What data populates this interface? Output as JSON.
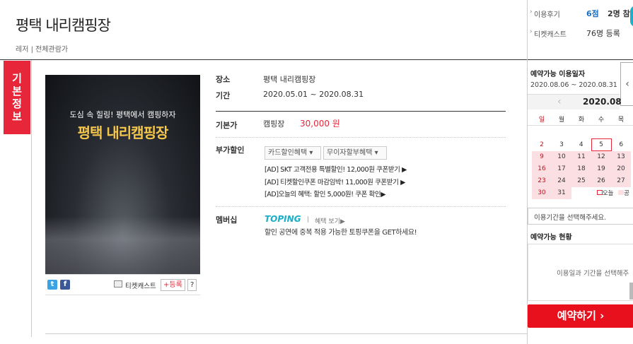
{
  "header": {
    "title": "평택 내리캠핑장",
    "breadcrumb": "레저 | 전체관람가"
  },
  "side_tab": {
    "chars": [
      "기",
      "본",
      "정",
      "보"
    ]
  },
  "poster": {
    "subtitle": "도심 속 힐링! 평택에서 캠핑하자",
    "main": "평택 내리캠핑장"
  },
  "poster_bar": {
    "ticketcast": "티켓캐스트",
    "register": "+등록",
    "help": "?"
  },
  "info": {
    "place_label": "장소",
    "place_value": "평택 내리캠핑장",
    "period_label": "기간",
    "period_value": "2020.05.01 ~ 2020.08.31",
    "price_label": "기본가",
    "price_item": "캠핑장",
    "price_value": "30,000 원",
    "discount_label": "부가할인",
    "card_btn": "카드할인혜택",
    "install_btn": "무이자할부혜택",
    "ads": [
      "[AD] SKT 고객전용 특별할인! 12,000원 쿠폰받기 ▶",
      "[AD] 티켓할인쿠폰 마감임박! 11,000원 쿠폰받기 ▶",
      "[AD]오늘의 혜택: 할인 5,000원! 쿠폰 확인▶"
    ],
    "member_label": "멤버십",
    "toping": "TOPING",
    "toping_link": "혜택 보기▶",
    "toping_desc": "할인 공연에 중복 적용 가능한 토핑쿠폰을 GET하세요!"
  },
  "right": {
    "review_label": "이용후기",
    "review_score": "6점",
    "review_count": "2명 참",
    "tc_label": "티켓캐스트",
    "tc_count": "76명 등록",
    "date_title": "예약가능 이용일자",
    "date_range": "2020.08.06 ~ 2020.08.31",
    "month": "2020.08",
    "weekdays": [
      "일",
      "월",
      "화",
      "수",
      "목"
    ],
    "weeks": [
      [
        "2",
        "3",
        "4",
        "5",
        "6"
      ],
      [
        "9",
        "10",
        "11",
        "12",
        "13"
      ],
      [
        "16",
        "17",
        "18",
        "19",
        "20"
      ],
      [
        "23",
        "24",
        "25",
        "26",
        "27"
      ],
      [
        "30",
        "31",
        "",
        "",
        ""
      ]
    ],
    "legend_today": "오늘",
    "legend_avail": "공",
    "select_period": "이용기간을 선택해주세요.",
    "status_title": "예약가능 현황",
    "status_msg": "이용일과 기간을 선택해주",
    "reserve": "예약하기 ›"
  },
  "colors": {
    "accent": "#e8263a",
    "price": "#e8263a",
    "reserve": "#e8101d",
    "toping": "#1ab0c9"
  }
}
